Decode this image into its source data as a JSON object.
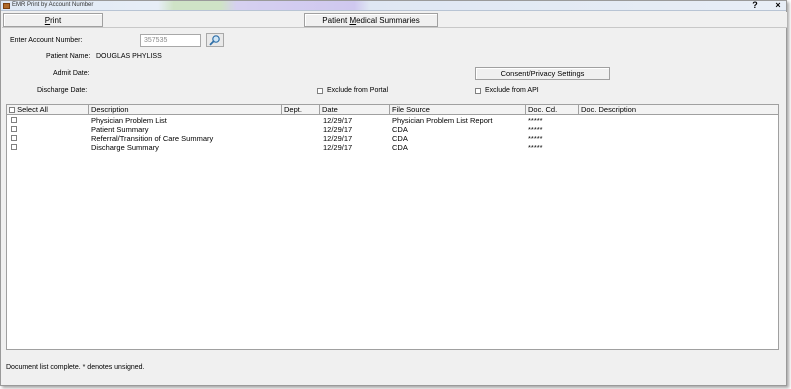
{
  "window": {
    "title": "EMR Print by Account Number",
    "help_label": "?",
    "close_label": "×"
  },
  "toolbar": {
    "print_label_u": "P",
    "print_label_rest": "rint",
    "summaries_label_pre": "Patient ",
    "summaries_label_u": "M",
    "summaries_label_rest": "edical Summaries"
  },
  "form": {
    "account_label": "Enter Account Number:",
    "account_value": "357535",
    "patient_name_label": "Patient Name:",
    "patient_name_value": "DOUGLAS PHYLISS",
    "admit_label": "Admit Date:",
    "discharge_label": "Discharge Date:",
    "consent_button": "Consent/Privacy Settings",
    "exclude_portal_label": "Exclude from Portal",
    "exclude_api_label": "Exclude from API"
  },
  "grid": {
    "headers": {
      "select_all": "Select All",
      "description": "Description",
      "dept": "Dept.",
      "date": "Date",
      "file_source": "File Source",
      "doc_cd": "Doc. Cd.",
      "doc_description": "Doc. Description"
    },
    "rows": [
      {
        "description": "Physician Problem List",
        "dept": "",
        "date": "12/29/17",
        "file_source": "Physician Problem List Report",
        "doc_cd": "*****",
        "doc_description": ""
      },
      {
        "description": "Patient Summary",
        "dept": "",
        "date": "12/29/17",
        "file_source": "CDA",
        "doc_cd": "*****",
        "doc_description": ""
      },
      {
        "description": "Referral/Transition of Care Summary",
        "dept": "",
        "date": "12/29/17",
        "file_source": "CDA",
        "doc_cd": "*****",
        "doc_description": ""
      },
      {
        "description": "Discharge Summary",
        "dept": "",
        "date": "12/29/17",
        "file_source": "CDA",
        "doc_cd": "*****",
        "doc_description": ""
      }
    ]
  },
  "status": {
    "message": "Document list complete.  * denotes unsigned."
  }
}
